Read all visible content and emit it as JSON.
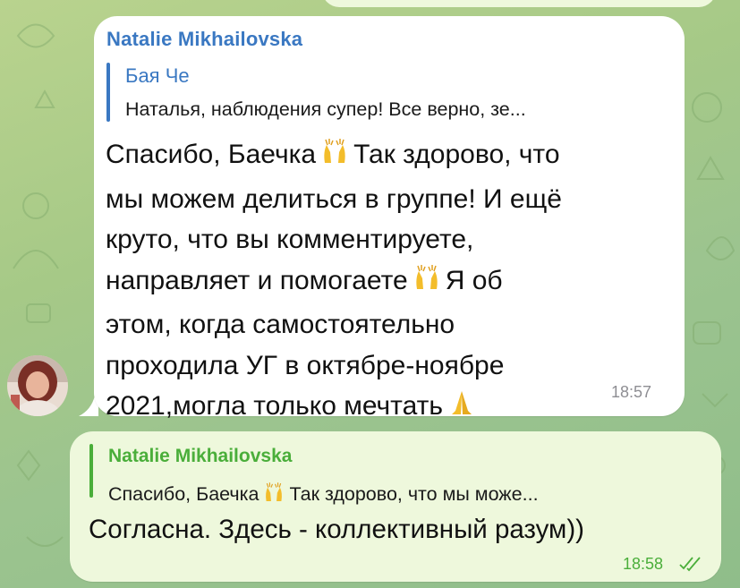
{
  "incoming": {
    "sender": "Natalie Mikhailovska",
    "reply_author": "Бая Че",
    "reply_text": "Наталья, наблюдения супер! Все верно, зе...",
    "text_lines": [
      "Спасибо, Баечка",
      "Так здорово, что",
      "мы можем делиться в группе! И ещё",
      "круто, что вы комментируете,",
      "направляет и помогаете",
      "Я об",
      "этом, когда самостоятельно",
      "проходила УГ в октябре-ноябре",
      "2021,могла только мечтать"
    ],
    "time": "18:57",
    "avatar_icon": "user-avatar-photo"
  },
  "outgoing": {
    "reply_author": "Natalie Mikhailovska",
    "reply_text_a": "Спасибо, Баечка",
    "reply_text_b": "Так здорово, что мы може...",
    "text": "Согласна. Здесь - коллективный разум))",
    "time": "18:58",
    "status_icon": "double-check-icon"
  },
  "colors": {
    "accent_blue": "#3a78c2",
    "accent_green": "#4aae3a",
    "outgoing_bg": "#eef8dc",
    "incoming_bg": "#ffffff"
  }
}
